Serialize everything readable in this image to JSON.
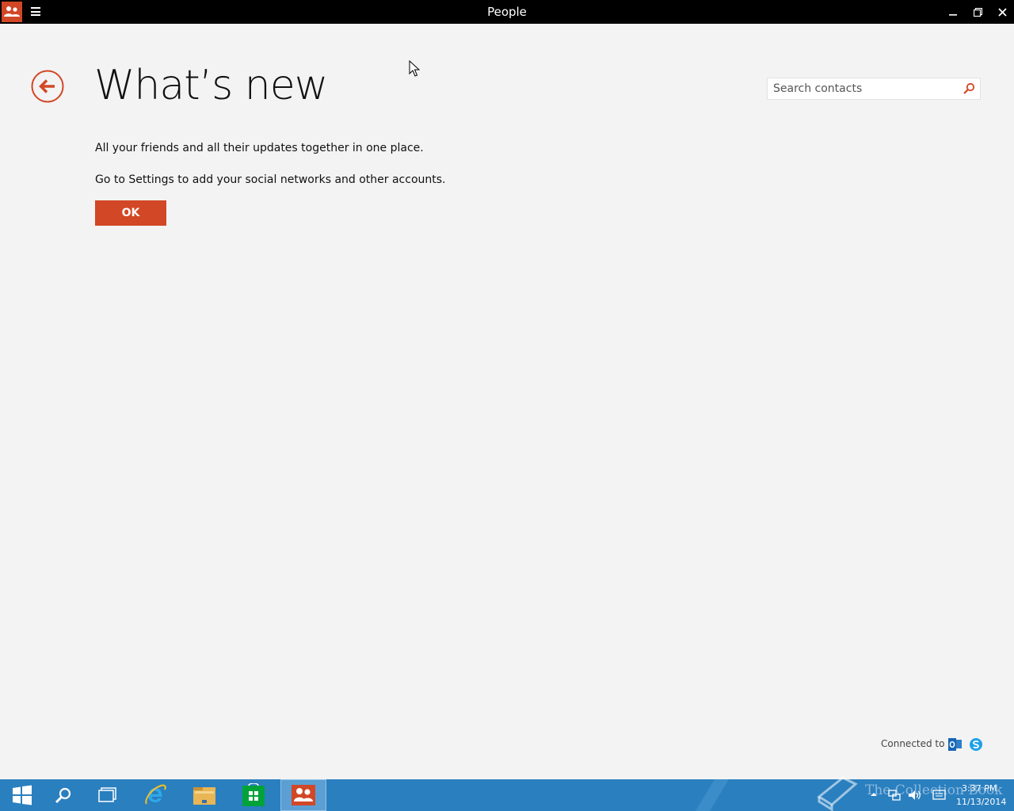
{
  "window": {
    "title": "People",
    "app_icon": "people-icon",
    "menu_icon": "hamburger-icon",
    "controls": [
      "minimize-icon",
      "restore-icon",
      "close-icon"
    ]
  },
  "page": {
    "title": "What’s new",
    "back_icon": "back-arrow-icon",
    "message_line1": "All your friends and all their updates together in one place.",
    "message_line2": "Go to Settings to add your social networks and other accounts.",
    "ok_label": "OK"
  },
  "search": {
    "placeholder": "Search contacts",
    "value": "",
    "icon": "search-icon"
  },
  "footer": {
    "connected_label": "Connected to",
    "services": [
      "outlook-icon",
      "skype-icon"
    ]
  },
  "taskbar": {
    "items": [
      "start-icon",
      "search-icon",
      "task-view-icon",
      "internet-explorer-icon",
      "file-explorer-icon",
      "store-icon",
      "people-icon"
    ],
    "active": "people-icon",
    "clock_time": "3:37 PM",
    "clock_date": "11/13/2014",
    "watermark": "The Collection Book"
  },
  "colors": {
    "accent": "#d24726",
    "background": "#f3f3f3",
    "titlebar": "#000000",
    "taskbar": "#2a7fbf"
  }
}
